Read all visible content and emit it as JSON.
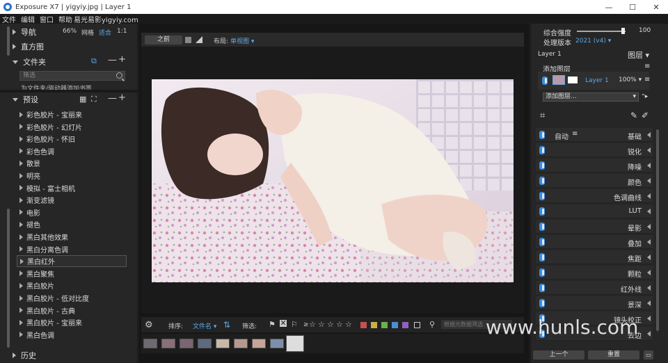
{
  "window": {
    "title": "Exposure X7 | yigyiy.jpg | Layer 1",
    "minimize": "—",
    "maximize": "☐",
    "close": "✕"
  },
  "menu": [
    "文件",
    "编辑",
    "窗口",
    "帮助",
    "易光易影yigyiy.com"
  ],
  "left": {
    "navigator": {
      "label": "导航",
      "zoom": "66%",
      "grid": "网格",
      "fit": "适合",
      "one": "1:1"
    },
    "histogram": "直方图",
    "folders": {
      "label": "文件夹",
      "search_placeholder": "筛选",
      "hint": "为文件夹/驱动器添加书签"
    },
    "presets": {
      "label": "预设",
      "items": [
        "彩色胶片 - 宝丽来",
        "彩色胶片 - 幻灯片",
        "彩色胶片 - 怀旧",
        "彩色色调",
        "散景",
        "明亮",
        "模拟 - 富士相机",
        "渐变滤镜",
        "电影",
        "褪色",
        "黑白其他效果",
        "黑白分离色调",
        "黑白红外",
        "黑白聚焦",
        "黑白胶片",
        "黑白胶片 - 低对比度",
        "黑白胶片 - 古典",
        "黑白胶片 - 宝丽来",
        "黑白色调"
      ],
      "selected_index": 12
    },
    "history": "历史"
  },
  "center": {
    "before_label": "之前",
    "layout_label": "布局:",
    "layout_value": "单视图",
    "sort_label": "排序:",
    "sort_value": "文件名",
    "filter_label": "筛选:",
    "rating_prefix": "≥",
    "meta_search_placeholder": "根据元数据筛选",
    "thumbnail_count": 9,
    "active_thumbnail": 8,
    "color_labels": [
      "#c85050",
      "#c8b048",
      "#6ab050",
      "#4a90d0",
      "#9060c0"
    ]
  },
  "right": {
    "strength_label": "综合强度",
    "strength_value": "100",
    "version_label": "处理版本",
    "version_value": "2021 (v4)",
    "layer_name": "Layer 1",
    "layers_label": "图层",
    "add_layer_label": "添加图层",
    "layer_opacity": "100%",
    "add_layer_dropdown": "添加图层...",
    "auto_label": "自动",
    "adjustments": [
      "基础",
      "锐化",
      "降噪",
      "颜色",
      "色调曲线",
      "LUT",
      "晕影",
      "叠加",
      "焦距",
      "颗粒",
      "红外线",
      "景深",
      "镜头校正",
      "去边"
    ],
    "prev_button": "上一个",
    "reset_button": "重置"
  },
  "watermark": "www.hunls.com"
}
